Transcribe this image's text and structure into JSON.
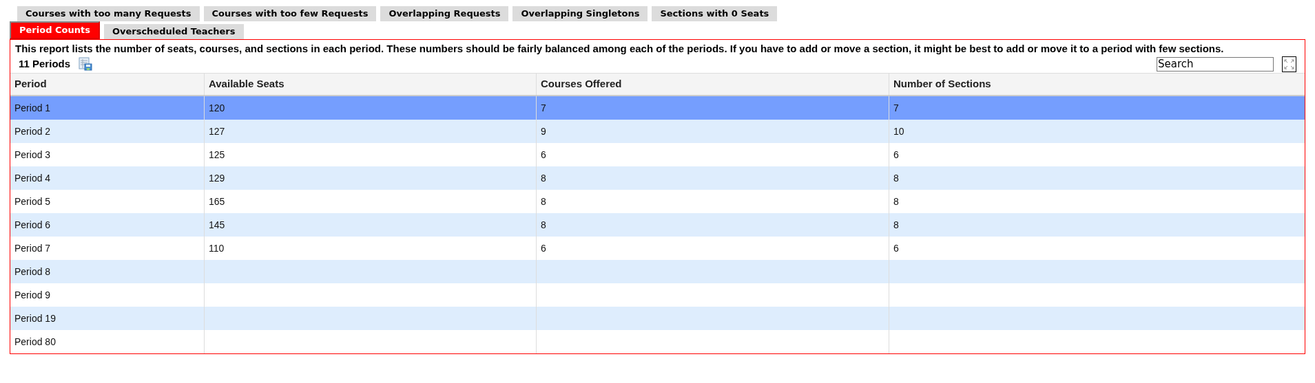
{
  "tabs": [
    {
      "label": "Courses with too many Requests",
      "selected": false
    },
    {
      "label": "Courses with too few Requests",
      "selected": false
    },
    {
      "label": "Overlapping Requests",
      "selected": false
    },
    {
      "label": "Overlapping Singletons",
      "selected": false
    },
    {
      "label": "Sections with 0 Seats",
      "selected": false
    }
  ],
  "tabs_row_2": [
    {
      "label": "Period Counts",
      "selected": true
    },
    {
      "label": "Overscheduled Teachers",
      "selected": false
    }
  ],
  "description": "This report lists the number of seats, courses, and sections in each period. These numbers should be fairly balanced among each of the periods. If you have to add or move a section, it might be best to add or move it to a period with few sections.",
  "count": "11 Periods",
  "search": {
    "value": "Search"
  },
  "table": {
    "columns": [
      "Period",
      "Available Seats",
      "Courses Offered",
      "Number of Sections"
    ],
    "rows": [
      {
        "cells": [
          "Period 1",
          "120",
          "7",
          "7"
        ],
        "selected": true
      },
      {
        "cells": [
          "Period 2",
          "127",
          "9",
          "10"
        ],
        "selected": false
      },
      {
        "cells": [
          "Period 3",
          "125",
          "6",
          "6"
        ],
        "selected": false
      },
      {
        "cells": [
          "Period 4",
          "129",
          "8",
          "8"
        ],
        "selected": false
      },
      {
        "cells": [
          "Period 5",
          "165",
          "8",
          "8"
        ],
        "selected": false
      },
      {
        "cells": [
          "Period 6",
          "145",
          "8",
          "8"
        ],
        "selected": false
      },
      {
        "cells": [
          "Period 7",
          "110",
          "6",
          "6"
        ],
        "selected": false
      },
      {
        "cells": [
          "Period 8",
          "",
          "",
          ""
        ],
        "selected": false
      },
      {
        "cells": [
          "Period 9",
          "",
          "",
          ""
        ],
        "selected": false
      },
      {
        "cells": [
          "Period 19",
          "",
          "",
          ""
        ],
        "selected": false
      },
      {
        "cells": [
          "Period 80",
          "",
          "",
          ""
        ],
        "selected": false
      }
    ]
  }
}
